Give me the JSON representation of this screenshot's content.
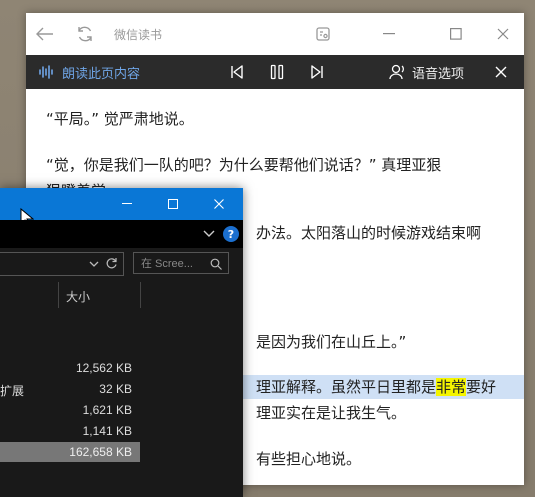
{
  "reader": {
    "app_title": "微信读书",
    "tts": {
      "label": "朗读此页内容",
      "voice_options": "语音选项"
    },
    "paragraphs": [
      "“平局。” 觉严肃地说。",
      "“觉，你是我们一队的吧？为什么要帮他们说话？” 真理亚狠",
      "狠瞪着觉。",
      "办法。太阳落山的时候游戏结束啊",
      "是因为我们在山丘上。”",
      "理亚解释。虽然平日里都是",
      "非常",
      "要好",
      "理亚实在是让我生气。",
      "有些担心地说。"
    ]
  },
  "explorer": {
    "search_placeholder": "在 Scree...",
    "column_size": "大小",
    "rows": [
      {
        "name": "",
        "size": "12,562 KB"
      },
      {
        "name": "扩展",
        "size": "32 KB"
      },
      {
        "name": "",
        "size": "1,621 KB"
      },
      {
        "name": "",
        "size": "1,141 KB"
      },
      {
        "name": "",
        "size": "162,658 KB"
      }
    ]
  },
  "colors": {
    "tts_bar": "#2b2b2b",
    "tts_accent": "#6fa5e6",
    "explorer_titlebar": "#0a77d6",
    "highlight_line": "#cfe0f5",
    "highlight_word": "#f5f500"
  }
}
